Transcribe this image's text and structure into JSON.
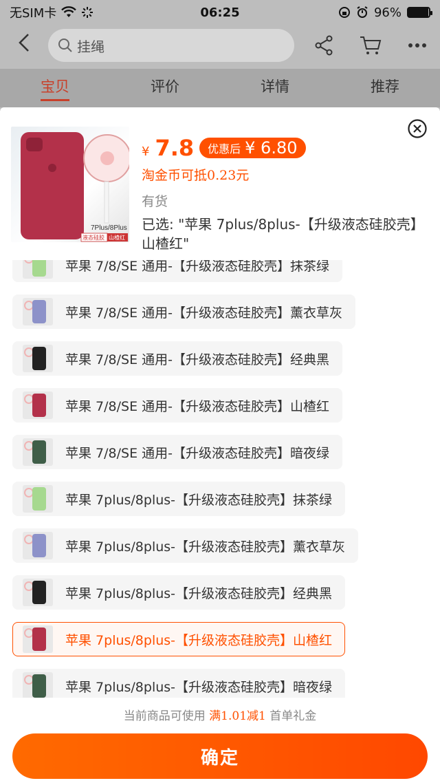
{
  "status_bar": {
    "carrier": "无SIM卡",
    "time": "06:25",
    "battery": "96%",
    "battery_level": 0.96
  },
  "nav": {
    "search_placeholder": "挂绳"
  },
  "tabs": [
    {
      "label": "宝贝",
      "active": true
    },
    {
      "label": "评价",
      "active": false
    },
    {
      "label": "详情",
      "active": false
    },
    {
      "label": "推荐",
      "active": false
    }
  ],
  "product": {
    "image_caption_model": "7Plus/8Plus",
    "image_caption_type": "液态硅胶",
    "image_caption_color": "山楂红",
    "price_symbol": "¥",
    "price": "7.8",
    "coupon_label": "优惠后",
    "coupon_price": "¥ 6.80",
    "coin_text": "淘金币可抵0.23元",
    "stock": "有货",
    "selected": "已选: \"苹果 7plus/8plus-【升级液态硅胶壳】山楂红\""
  },
  "options": [
    {
      "label": "苹果 7/8/SE 通用-【升级液态硅胶壳】抹茶绿",
      "color": "#a6d98f",
      "active": false
    },
    {
      "label": "苹果 7/8/SE 通用-【升级液态硅胶壳】薰衣草灰",
      "color": "#8d92c9",
      "active": false
    },
    {
      "label": "苹果 7/8/SE 通用-【升级液态硅胶壳】经典黑",
      "color": "#222222",
      "active": false
    },
    {
      "label": "苹果 7/8/SE 通用-【升级液态硅胶壳】山楂红",
      "color": "#b3314a",
      "active": false
    },
    {
      "label": "苹果 7/8/SE 通用-【升级液态硅胶壳】暗夜绿",
      "color": "#3f5e48",
      "active": false
    },
    {
      "label": "苹果 7plus/8plus-【升级液态硅胶壳】抹茶绿",
      "color": "#a6d98f",
      "active": false
    },
    {
      "label": "苹果 7plus/8plus-【升级液态硅胶壳】薰衣草灰",
      "color": "#8d92c9",
      "active": false
    },
    {
      "label": "苹果 7plus/8plus-【升级液态硅胶壳】经典黑",
      "color": "#222222",
      "active": false
    },
    {
      "label": "苹果 7plus/8plus-【升级液态硅胶壳】山楂红",
      "color": "#b3314a",
      "active": true
    },
    {
      "label": "苹果 7plus/8plus-【升级液态硅胶壳】暗夜绿",
      "color": "#3f5e48",
      "active": false
    }
  ],
  "promo": {
    "prefix": "当前商品可使用 ",
    "highlight": "满1.01减1",
    "suffix": " 首单礼金"
  },
  "confirm_label": "确定",
  "colors": {
    "accent": "#ff5000",
    "tab_active": "#c8402a"
  }
}
